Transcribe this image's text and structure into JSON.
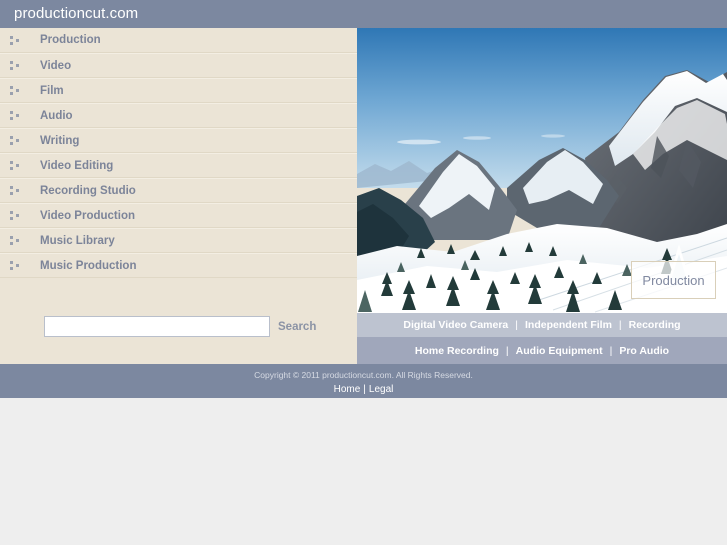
{
  "header": {
    "title": "productioncut.com"
  },
  "sidebar": {
    "items": [
      {
        "label": "Production",
        "icon": "sitemap-icon"
      },
      {
        "label": "Video",
        "icon": "sitemap-icon"
      },
      {
        "label": "Film",
        "icon": "sitemap-icon"
      },
      {
        "label": "Audio",
        "icon": "sitemap-icon"
      },
      {
        "label": "Writing",
        "icon": "sitemap-icon"
      },
      {
        "label": "Video Editing",
        "icon": "sitemap-icon"
      },
      {
        "label": "Recording Studio",
        "icon": "sitemap-icon"
      },
      {
        "label": "Video Production",
        "icon": "sitemap-icon"
      },
      {
        "label": "Music Library",
        "icon": "sitemap-icon"
      },
      {
        "label": "Music Production",
        "icon": "sitemap-icon"
      }
    ]
  },
  "search": {
    "value": "",
    "placeholder": "",
    "button_label": "Search"
  },
  "photo": {
    "badge_label": "Production",
    "alt": "snowy mountain landscape with evergreen trees"
  },
  "linkbar_top": {
    "links": [
      "Digital Video Camera",
      "Independent Film",
      "Recording"
    ],
    "separator": "|"
  },
  "linkbar_bottom": {
    "links": [
      "Home Recording",
      "Audio Equipment",
      "Pro Audio"
    ],
    "separator": "|"
  },
  "footer": {
    "copyright": "Copyright © 2011 productioncut.com. All Rights Reserved.",
    "links": [
      "Home",
      "Legal"
    ],
    "separator": "|"
  },
  "colors": {
    "header_bg": "#7c88a0",
    "sidebar_bg": "#ebe4d6",
    "menu_text": "#7c8499",
    "linkbar_top_bg": "#bdc3d0",
    "linkbar_bottom_bg": "#a0a7bb",
    "footer_bg": "#7c88a0",
    "page_bg": "#eeeeee"
  }
}
